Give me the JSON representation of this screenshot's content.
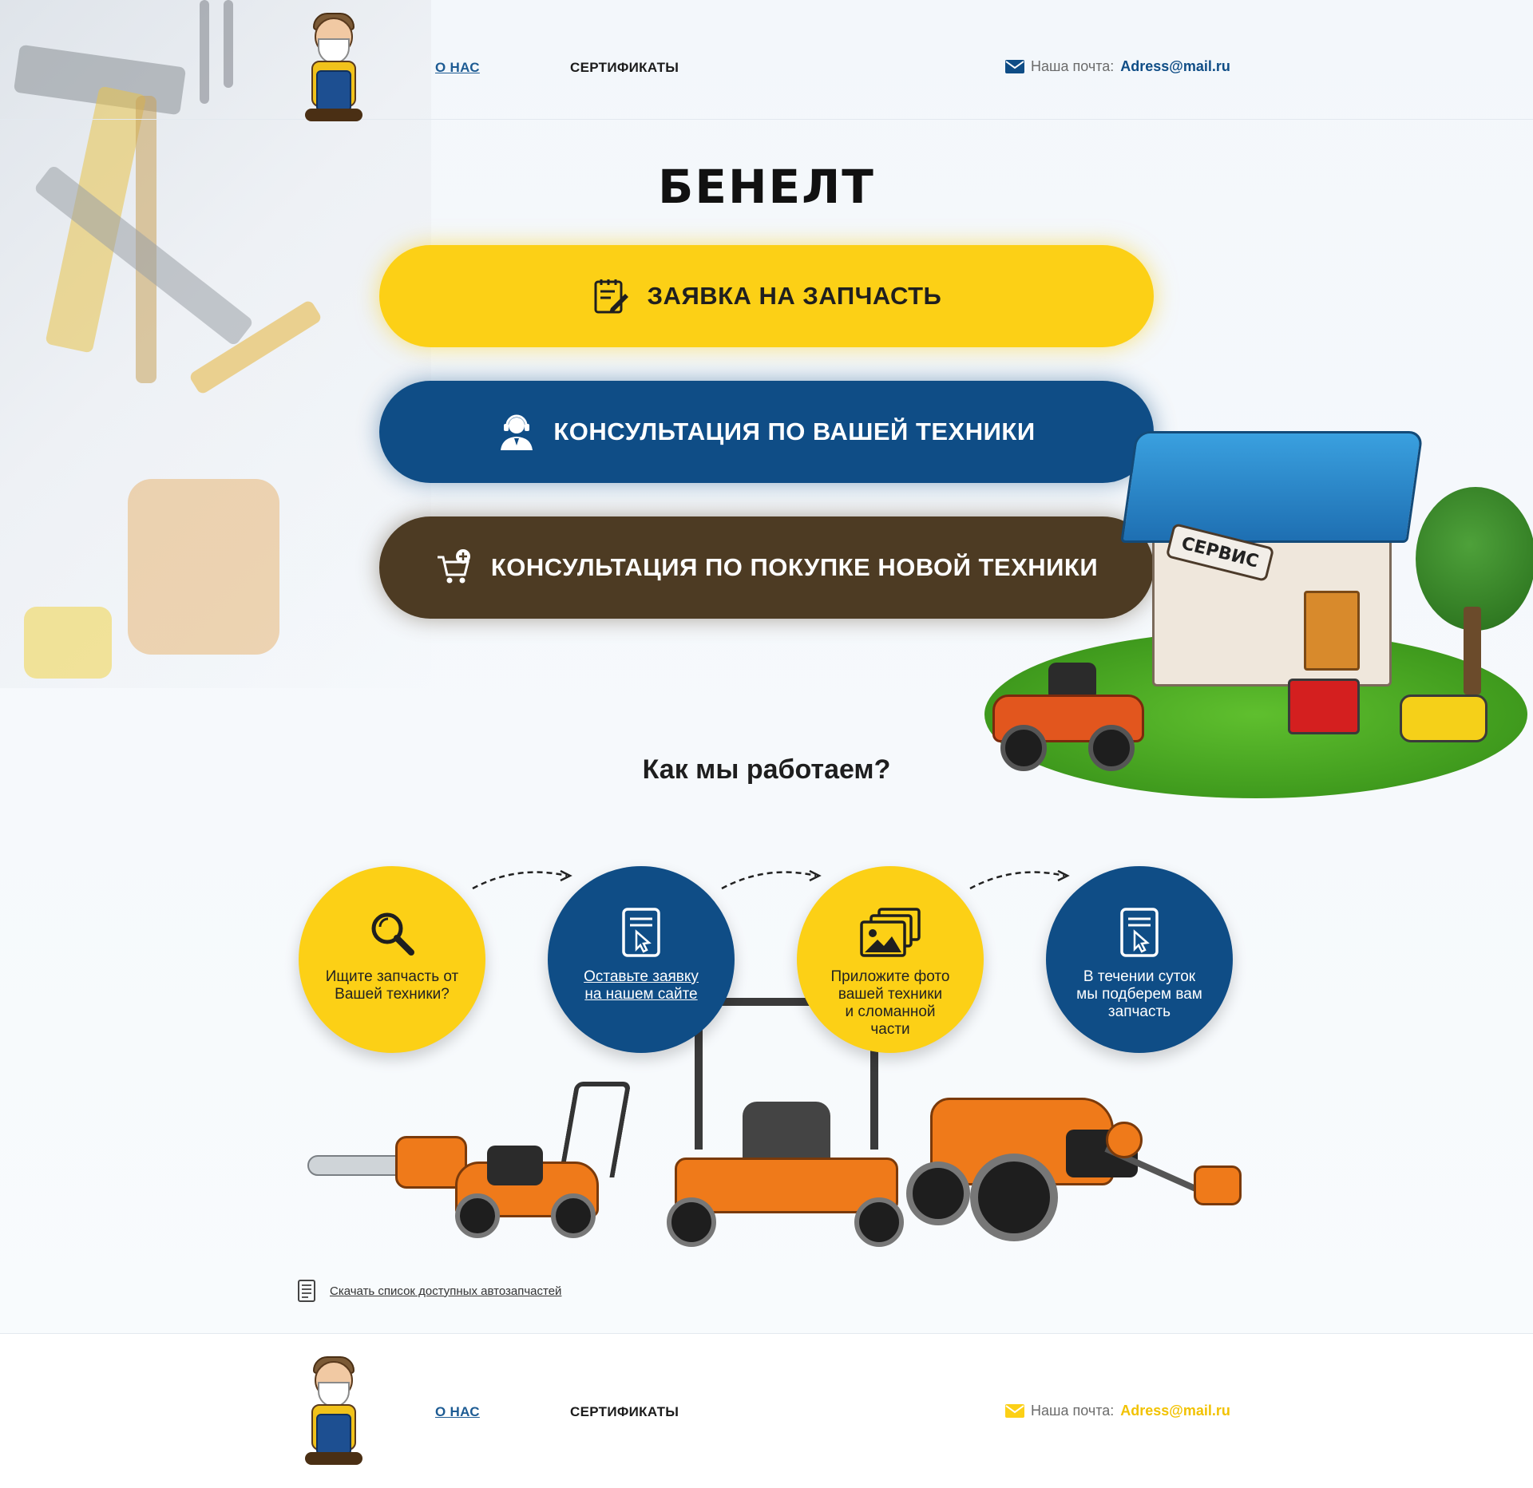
{
  "header": {
    "nav": {
      "about": "О НАС",
      "certificates": "СЕРТИФИКАТЫ"
    },
    "mail": {
      "label": "Наша почта:",
      "value": "Adress@mail.ru",
      "color": "#0f4d86"
    }
  },
  "brand": {
    "title": "БЕНЕЛТ"
  },
  "cta": {
    "spare_part": {
      "label": "ЗАЯВКА НА ЗАПЧАСТЬ",
      "color": "#fcd016",
      "icon": "request-form-icon"
    },
    "consultation": {
      "label": "КОНСУЛЬТАЦИЯ ПО ВАШЕЙ ТЕХНИКИ",
      "color": "#0f4d86",
      "icon": "support-agent-icon"
    },
    "purchase": {
      "label": "КОНСУЛЬТАЦИЯ ПО ПОКУПКЕ НОВОЙ ТЕХНИКИ",
      "color": "#4d3b23",
      "icon": "cart-add-icon"
    }
  },
  "service_illustration": {
    "sign": "СЕРВИС"
  },
  "how_we_work": {
    "title": "Как мы работаем?",
    "steps": [
      {
        "text": "Ищите запчасть от\nВашей техники?",
        "icon": "magnifier-icon",
        "color": "#fcd016"
      },
      {
        "text": "Оставьте заявку\nна нашем сайте",
        "icon": "form-click-icon",
        "color": "#0f4d86"
      },
      {
        "text": "Приложите фото\nвашей техники\nи сломанной\nчасти",
        "icon": "photos-icon",
        "color": "#fcd016"
      },
      {
        "text": "В течении суток\nмы подберем вам\nзапчасть",
        "icon": "form-click-icon",
        "color": "#0f4d86"
      }
    ]
  },
  "download": {
    "label": "Скачать список доступных автозапчастей",
    "icon": "document-list-icon"
  },
  "footer": {
    "nav": {
      "about": "О НАС",
      "certificates": "СЕРТИФИКАТЫ"
    },
    "mail": {
      "label": "Наша почта:",
      "value": "Adress@mail.ru",
      "color": "#fcd016"
    }
  }
}
